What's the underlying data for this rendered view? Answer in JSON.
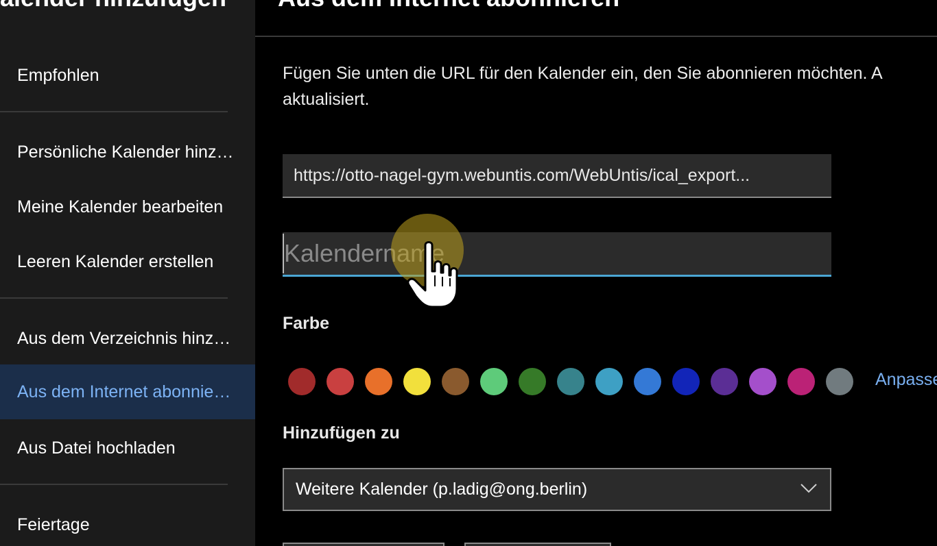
{
  "sidebar": {
    "title": "alender hinzufügen",
    "items": [
      {
        "label": "Empfohlen"
      },
      {
        "label": "Persönliche Kalender hinzufügen"
      },
      {
        "label": "Meine Kalender bearbeiten"
      },
      {
        "label": "Leeren Kalender erstellen"
      },
      {
        "label": "Aus dem Verzeichnis hinzufügen"
      },
      {
        "label": "Aus dem Internet abonnieren"
      },
      {
        "label": "Aus Datei hochladen"
      },
      {
        "label": "Feiertage"
      }
    ],
    "selected_index": 5
  },
  "main": {
    "title": "Aus dem Internet abonnieren",
    "intro": "Fügen Sie unten die URL für den Kalender ein, den Sie abonnieren möchten. A aktualisiert.",
    "url_value": "https://otto-nagel-gym.webuntis.com/WebUntis/ical_export...",
    "name_placeholder": "Kalendername",
    "color_label": "Farbe",
    "colors": [
      "#a12b2b",
      "#c94040",
      "#e8702a",
      "#f2e03c",
      "#8a5a2e",
      "#5ecb7a",
      "#367a28",
      "#37838c",
      "#3ea0c4",
      "#3479d6",
      "#1225b8",
      "#5b2e95",
      "#a44fcb",
      "#bb2276",
      "#717b7f"
    ],
    "customize_label": "Anpassen",
    "add_to_label": "Hinzufügen zu",
    "add_to_value": "Weitere Kalender (p.ladig@ong.berlin)"
  }
}
